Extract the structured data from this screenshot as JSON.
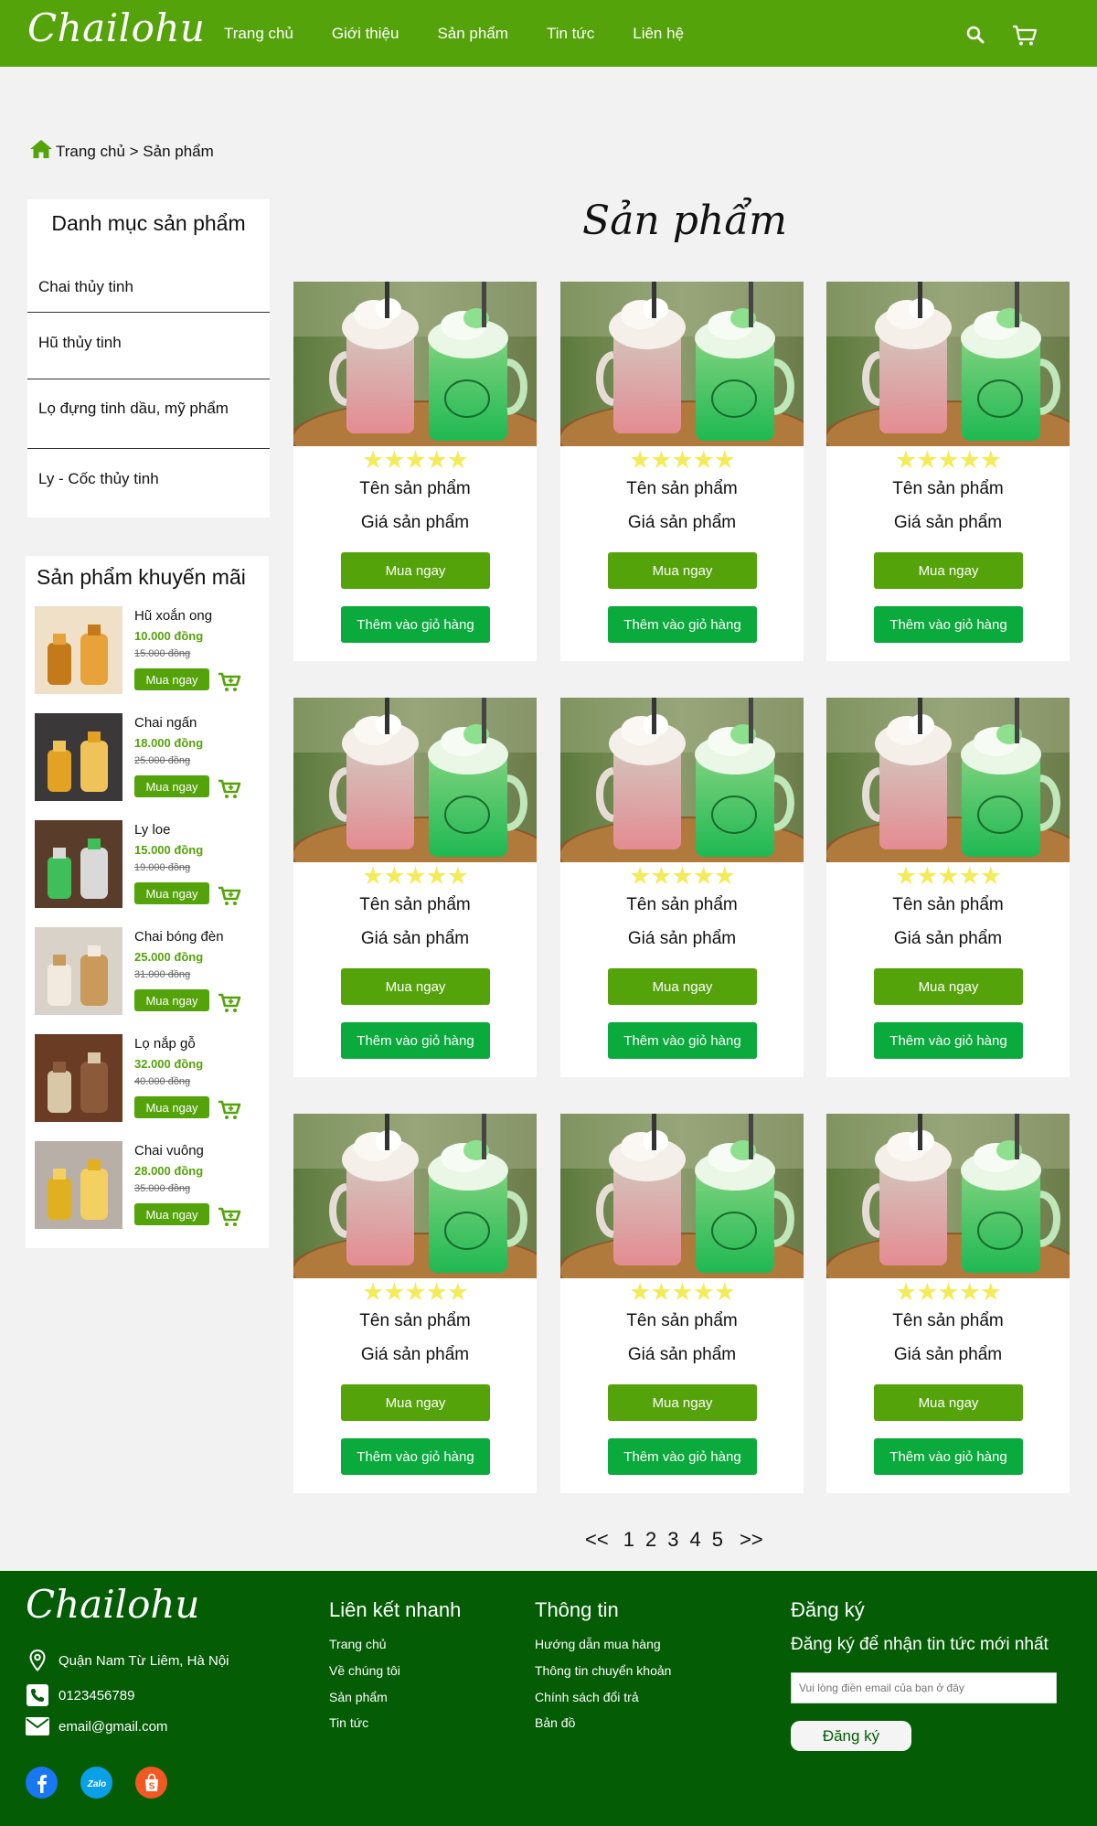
{
  "header": {
    "logo": "Chailohu",
    "nav": [
      "Trang chủ",
      "Giới thiệu",
      "Sản phẩm",
      "Tin tức",
      "Liên hệ"
    ]
  },
  "breadcrumb": {
    "text": "Trang chủ > Sản phẩm"
  },
  "categories": {
    "title": "Danh mục sản phẩm",
    "items": [
      "Chai thủy tinh",
      "Hũ thủy tinh",
      "Lọ đựng tinh dầu, mỹ phẩm",
      "Ly - Cốc thủy tinh"
    ]
  },
  "promo": {
    "title": "Sản phẩm khuyến mãi",
    "buy_label": "Mua ngay",
    "items": [
      {
        "name": "Hũ xoắn ong",
        "price": "10.000 đồng",
        "old_price": "15.000 đồng"
      },
      {
        "name": "Chai ngấn",
        "price": "18.000 đồng",
        "old_price": "25.000 đồng"
      },
      {
        "name": "Ly loe",
        "price": "15.000 đồng",
        "old_price": "19.000 đồng"
      },
      {
        "name": "Chai bóng đèn",
        "price": "25.000 đồng",
        "old_price": "31.000 đồng"
      },
      {
        "name": "Lọ nắp gỗ",
        "price": "32.000 đồng",
        "old_price": "40.000 đồng"
      },
      {
        "name": "Chai vuông",
        "price": "28.000 đồng",
        "old_price": "35.000 đồng"
      }
    ]
  },
  "main": {
    "title": "Sản phẩm",
    "card": {
      "name": "Tên sản phẩm",
      "price": "Giá sản phẩm",
      "stars": "★★★★★",
      "rating": 5,
      "buy_label": "Mua ngay",
      "add_label": "Thêm vào giỏ hàng"
    },
    "card_count": 9
  },
  "pagination": [
    "<<",
    "1",
    "2",
    "3",
    "4",
    "5",
    ">>"
  ],
  "footer": {
    "logo": "Chailohu",
    "address": "Quận Nam Từ Liêm, Hà Nội",
    "phone": "0123456789",
    "email": "email@gmail.com",
    "quick_links_title": "Liên kết nhanh",
    "quick_links": [
      "Trang chủ",
      "Về chúng tôi",
      "Sản phẩm",
      "Tin tức"
    ],
    "info_title": "Thông tin",
    "info_links": [
      "Hướng dẫn mua hàng",
      "Thông tin chuyển khoản",
      "Chính sách đổi trả",
      "Bản đồ"
    ],
    "subscribe_title": "Đăng ký",
    "subscribe_text": "Đăng ký để nhận tin tức mới nhất",
    "email_placeholder": "Vui lòng điền email của bạn ở đây",
    "subscribe_button": "Đăng ký",
    "social": [
      "facebook-icon",
      "zalo-icon",
      "shopee-icon"
    ]
  },
  "colors": {
    "brand_green": "#55a30a",
    "add_green": "#0aaa3c",
    "footer_green": "#045c05",
    "star": "#f2ec5a"
  }
}
